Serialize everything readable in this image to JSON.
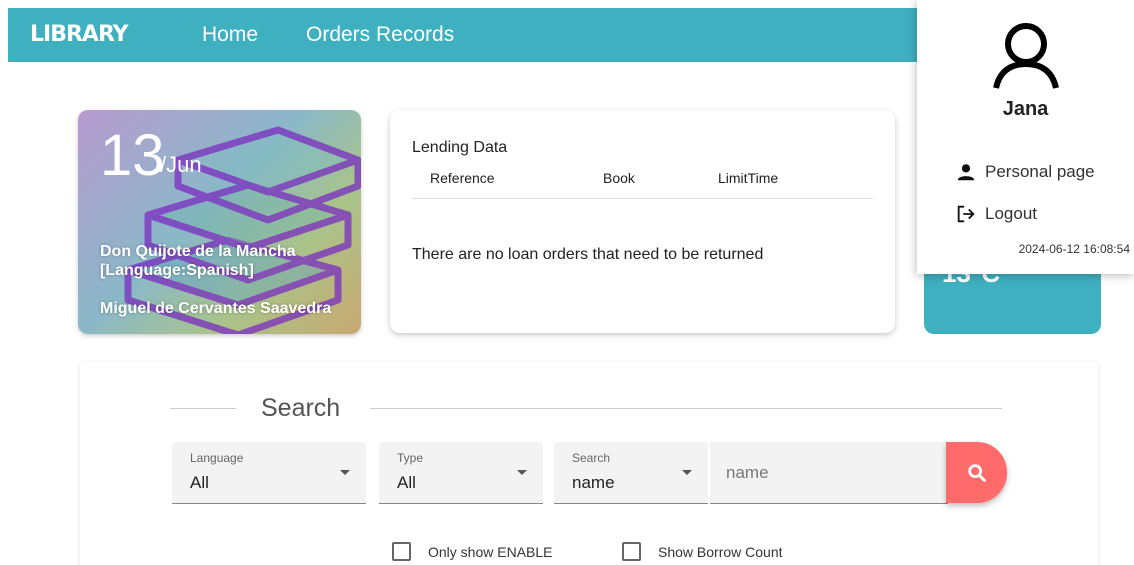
{
  "nav": {
    "brand": "LIBRARY",
    "home": "Home",
    "orders": "Orders Records"
  },
  "featured": {
    "day": "13",
    "month": "/Jun",
    "book_title": "Don Quijote de la Mancha",
    "language": "[Language:Spanish]",
    "author": "Miguel de Cervantes Saavedra"
  },
  "lending": {
    "title": "Lending Data",
    "columns": [
      "Reference",
      "Book",
      "LimitTime"
    ],
    "empty_message": "There are no loan orders that need to be returned"
  },
  "teal_card": {
    "text": "13°C"
  },
  "user_menu": {
    "name": "Jana",
    "personal_page": "Personal page",
    "logout": "Logout",
    "timestamp": "2024-06-12 16:08:54"
  },
  "search": {
    "legend": "Search",
    "language": {
      "label": "Language",
      "value": "All"
    },
    "type": {
      "label": "Type",
      "value": "All"
    },
    "field": {
      "label": "Search",
      "value": "name"
    },
    "input_placeholder": "name",
    "only_enable": "Only show ENABLE",
    "borrow_count": "Show Borrow Count"
  },
  "colors": {
    "primary": "#3fb0c0",
    "search_button": "#ff6b6b"
  }
}
